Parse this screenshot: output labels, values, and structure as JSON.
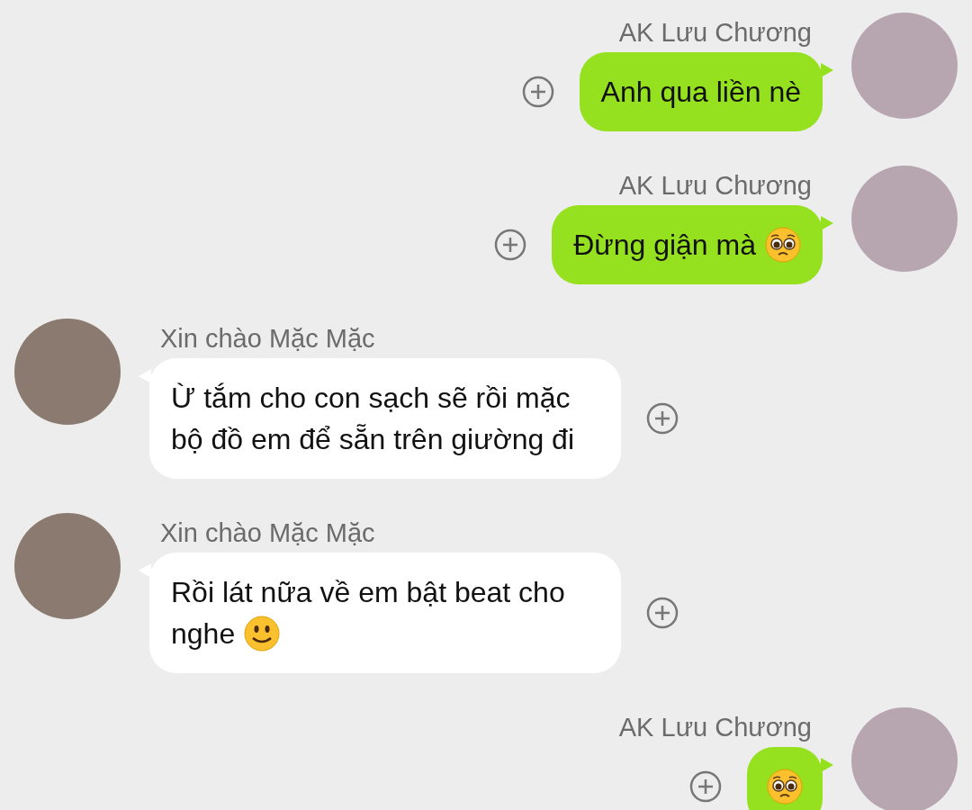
{
  "messages": [
    {
      "kind": "outgoing",
      "sender": "AK Lưu Chương",
      "parts": [
        {
          "kind": "text",
          "text": "Anh qua liền nè"
        }
      ]
    },
    {
      "kind": "outgoing",
      "sender": "AK Lưu Chương",
      "parts": [
        {
          "kind": "text",
          "text": "Đừng giận mà"
        },
        {
          "kind": "pleading-face"
        }
      ]
    },
    {
      "kind": "incoming",
      "sender": "Xin chào Mặc Mặc",
      "parts": [
        {
          "kind": "text",
          "text": "Ừ tắm cho con sạch sẽ rồi mặc bộ đồ em để sẵn trên giường đi"
        }
      ]
    },
    {
      "kind": "incoming",
      "sender": "Xin chào Mặc Mặc",
      "parts": [
        {
          "kind": "text",
          "text": "Rồi lát nữa về em bật beat cho nghe"
        },
        {
          "kind": "smiley"
        }
      ]
    },
    {
      "kind": "outgoing",
      "sender": "AK Lưu Chương",
      "parts": [
        {
          "kind": "pleading-face"
        }
      ]
    }
  ]
}
